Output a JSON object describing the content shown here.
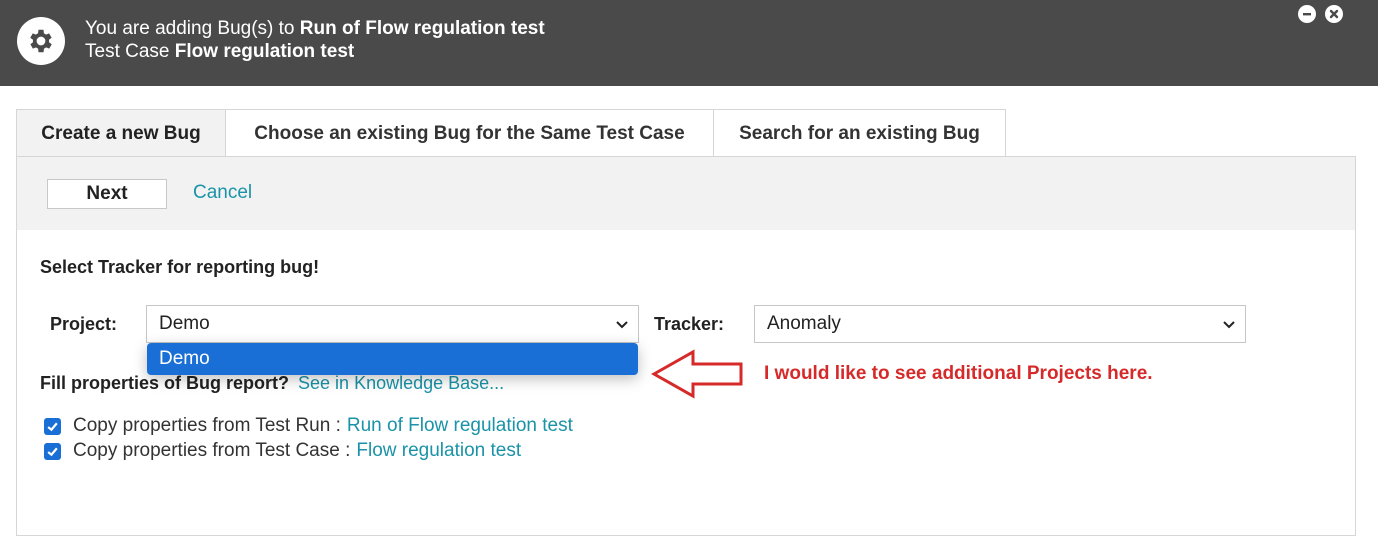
{
  "header": {
    "line1_prefix": "You are adding Bug(s) to",
    "line1_run": "Run of Flow regulation test",
    "line2_prefix": "Test Case",
    "line2_case": "Flow regulation test",
    "icon": "gear-icon",
    "minimize_icon": "minimize-icon",
    "close_icon": "close-icon"
  },
  "tabs": [
    {
      "label": "Create a new Bug",
      "active": true
    },
    {
      "label": "Choose an existing Bug for the Same Test Case",
      "active": false
    },
    {
      "label": "Search for an existing Bug",
      "active": false
    }
  ],
  "toolbar": {
    "next_label": "Next",
    "cancel_label": "Cancel"
  },
  "form": {
    "heading": "Select Tracker for reporting bug!",
    "project_label": "Project:",
    "project_value": "Demo",
    "project_options": [
      "Demo"
    ],
    "tracker_label": "Tracker:",
    "tracker_value": "Anomaly",
    "fill_label": "Fill properties of Bug report?",
    "fill_link": "See in Knowledge Base...",
    "copy_run_label": "Copy properties from Test Run :",
    "copy_run_link": "Run of Flow regulation test",
    "copy_run_checked": true,
    "copy_case_label": "Copy properties from Test Case :",
    "copy_case_link": "Flow regulation test",
    "copy_case_checked": true
  },
  "annotation": {
    "text": "I would like to see additional Projects here.",
    "color": "#d62a2a"
  },
  "colors": {
    "header_bg": "#4a4a4a",
    "link": "#1a93a8",
    "accent": "#1a6fd6"
  }
}
